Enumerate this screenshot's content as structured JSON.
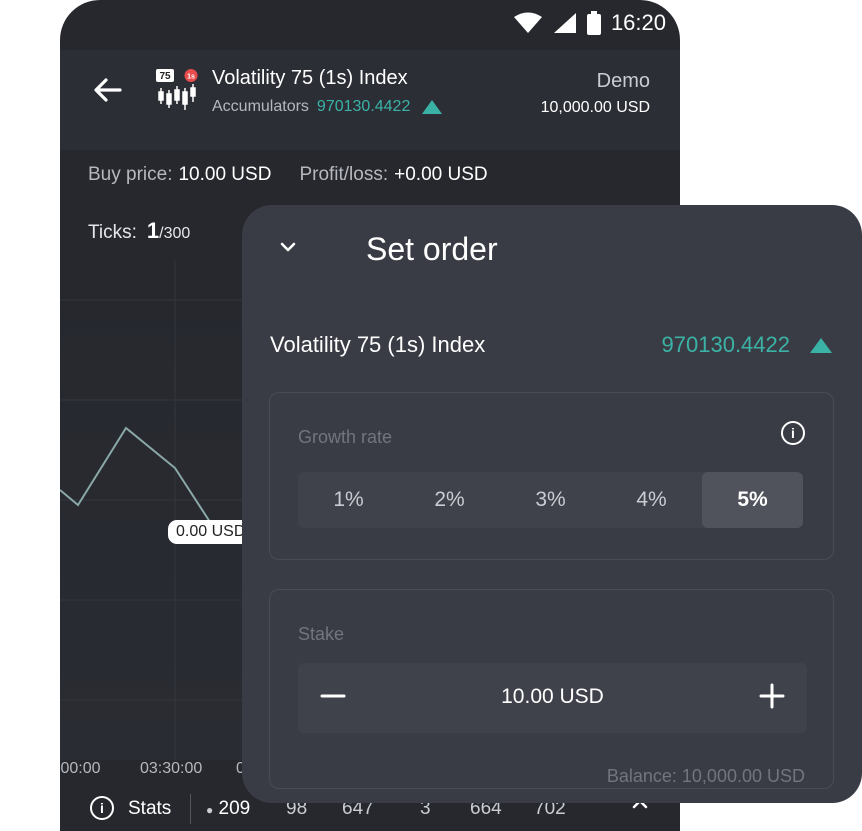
{
  "status": {
    "time": "16:20"
  },
  "header": {
    "symbol_title": "Volatility 75 (1s) Index",
    "trade_type": "Accumulators",
    "price": "970130.4422",
    "account_type": "Demo",
    "account_balance": "10,000.00 USD",
    "symbol_badge_1": "75",
    "symbol_badge_2": "1s"
  },
  "contract": {
    "buy_price_label": "Buy price:",
    "buy_price": "10.00 USD",
    "pnl_label": "Profit/loss:",
    "pnl": "+0.00 USD",
    "ticks_label": "Ticks:",
    "ticks_current": "1",
    "ticks_total": "/300"
  },
  "chart": {
    "price_label": "0.00 USD",
    "time_labels": [
      ":00:00",
      "03:30:00",
      "0"
    ],
    "line_color": "#8aa8a8"
  },
  "stats": {
    "label": "Stats",
    "values": [
      "209",
      "98",
      "647",
      "3",
      "664",
      "702"
    ]
  },
  "sheet": {
    "title": "Set order",
    "symbol": "Volatility 75 (1s) Index",
    "price": "970130.4422",
    "growth_label": "Growth rate",
    "rates": [
      "1%",
      "2%",
      "3%",
      "4%",
      "5%"
    ],
    "selected_rate": "5%",
    "stake_label": "Stake",
    "stake_value": "10.00 USD",
    "balance": "Balance: 10,000.00 USD"
  },
  "colors": {
    "accent": "#3ab3a6",
    "background": "#26282e",
    "sheet": "#3a3c45"
  }
}
